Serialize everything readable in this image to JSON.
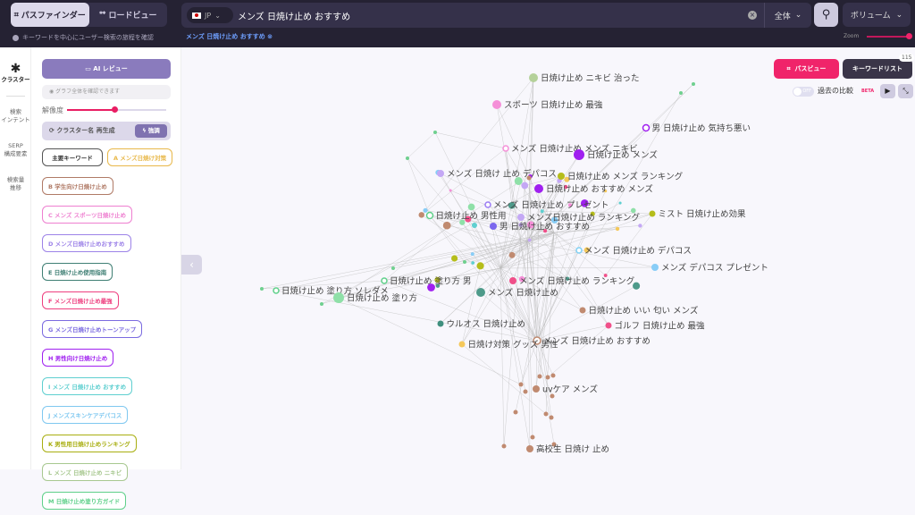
{
  "header": {
    "modes": [
      {
        "label": "パスファインダー",
        "icon": "path-icon",
        "active": true
      },
      {
        "label": "ロードビュー",
        "icon": "route-icon",
        "active": false
      }
    ],
    "hint": "キーワードを中心にユーザー検索の旅程を確認",
    "country": "JP",
    "query": "メンズ 日焼け止め おすすめ",
    "scope": "全体",
    "metric": "ボリューム",
    "breadcrumb": "メンズ 日焼け止め おすすめ",
    "zoom_label": "Zoom",
    "zoom_level": 1.0
  },
  "rail": [
    {
      "label": "クラスター",
      "active": true
    },
    {
      "label": "検索\nインテント"
    },
    {
      "label": "SERP\n構成要素"
    },
    {
      "label": "検索量\n推移"
    }
  ],
  "panel": {
    "ai_review": "AI レビュー",
    "graph_hint": "グラフ全体を確認できます",
    "resolution_label": "解像度",
    "resolution": 0.5,
    "regen": "クラスター名 再生成",
    "strong": "強調",
    "chips": [
      {
        "label": "主要キーワード",
        "color": "#555555"
      },
      {
        "label": "A メンズ日焼け対策",
        "color": "#e8b84a"
      },
      {
        "label": "B 学生向け日焼け止め",
        "color": "#b07a66"
      },
      {
        "label": "C メンズ スポーツ日焼け止め",
        "color": "#ee7fd0"
      },
      {
        "label": "D メンズ日焼け止めおすすめ",
        "color": "#9d83e8"
      },
      {
        "label": "E 日焼け止め使用指南",
        "color": "#3f7f74"
      },
      {
        "label": "F メンズ日焼け止め最強",
        "color": "#ee3f7f"
      },
      {
        "label": "G メンズ日焼け止めトーンアップ",
        "color": "#7b6be0"
      },
      {
        "label": "H 男性向け日焼け止め",
        "color": "#a020f0"
      },
      {
        "label": "I メンズ 日焼け止め おすすめ",
        "color": "#5fcfd0"
      },
      {
        "label": "J メンズスキンケアデパコス",
        "color": "#7fc8f0"
      },
      {
        "label": "K 男性用日焼け止めランキング",
        "color": "#a8ae10"
      },
      {
        "label": "L メンズ 日焼け止め ニキビ",
        "color": "#a8c890"
      },
      {
        "label": "M 日焼け止め塗り方ガイド",
        "color": "#5fd08a"
      }
    ]
  },
  "toolbar": {
    "path_view": "パスビュー",
    "keyword_list": "キーワードリスト",
    "keyword_count": "115",
    "compare_toggle": "OFF",
    "compare_label": "過去の比較",
    "beta": "BETA"
  },
  "graph": {
    "nodes": [
      {
        "label": "日焼け止め ニキビ 治った",
        "color": "#b5d19a"
      },
      {
        "label": "スポーツ 日焼け止め 最強",
        "color": "#f58fd8"
      },
      {
        "label": "男 日焼け止め 気持ち悪い",
        "color": "#a020f0",
        "hollow": true
      },
      {
        "label": "メンズ 日焼け止め メンズ ニキビ",
        "color": "#f58fd8",
        "hollow": true
      },
      {
        "label": "日焼け止め メンズ",
        "color": "#a020f0"
      },
      {
        "label": "メンズ 日焼け 止め デパコス",
        "color": "#c4a8f5"
      },
      {
        "label": "日焼け止め メンズ ランキング",
        "color": "#b5bd1a"
      },
      {
        "label": "日焼け止め おすすめ メンズ",
        "color": "#a020f0"
      },
      {
        "label": "メンズ 日焼け止め プレゼント",
        "color": "#9b7cf5",
        "hollow": true
      },
      {
        "label": "日焼け止め 男性用",
        "color": "#5fd08a",
        "hollow": true
      },
      {
        "label": "メンズ日焼け止め ランキング",
        "color": "#c4a8f5"
      },
      {
        "label": "男 日焼け止め おすすめ",
        "color": "#7b68ee"
      },
      {
        "label": "ミスト 日焼け止め効果",
        "color": "#b5bd1a"
      },
      {
        "label": "メンズ 日焼け止め デパコス",
        "color": "#7fd0f5",
        "hollow": true
      },
      {
        "label": "メンズ デパコス プレゼント",
        "color": "#88cdf7"
      },
      {
        "label": "日焼け止め 塗り方 男",
        "color": "#5fd08a",
        "hollow": true
      },
      {
        "label": "メンズ 日焼け止め ランキング",
        "color": "#f0508a"
      },
      {
        "label": "日焼け止め 塗り方 ソレダメ",
        "color": "#5fd08a",
        "hollow": true
      },
      {
        "label": "日焼け止め 塗り方",
        "color": "#8fe0a8"
      },
      {
        "label": "メンズ 日焼け止め",
        "color": "#4e9a8a"
      },
      {
        "label": "日焼け止め いい 匂い メンズ",
        "color": "#c08a70"
      },
      {
        "label": "ゴルフ 日焼け止め 最強",
        "color": "#f0508a"
      },
      {
        "label": "ウルオス 日焼け止め",
        "color": "#3f8f7e"
      },
      {
        "label": "メンズ 日焼け止め おすすめ",
        "color": "#c08a70",
        "hollow": true
      },
      {
        "label": "日焼け対策 グッズ 男性",
        "color": "#f5c85a"
      },
      {
        "label": "uvケア メンズ",
        "color": "#c08a70"
      },
      {
        "label": "高校生 日焼け 止め",
        "color": "#c08a70"
      }
    ]
  }
}
